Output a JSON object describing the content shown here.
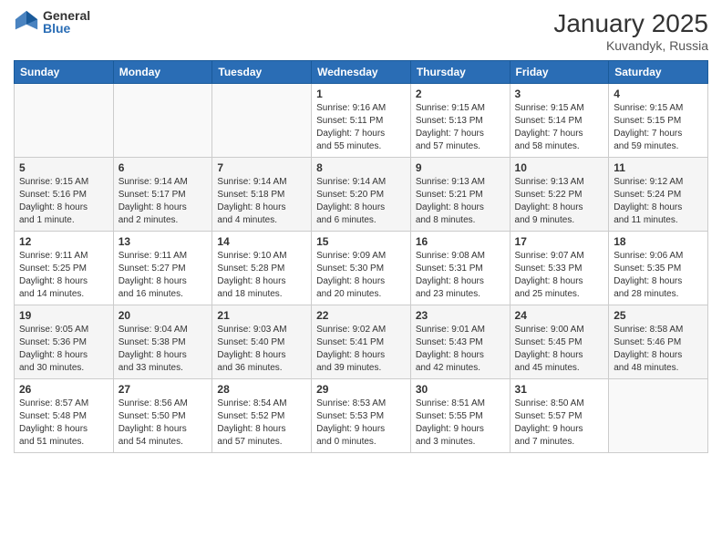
{
  "logo": {
    "general": "General",
    "blue": "Blue"
  },
  "title": "January 2025",
  "subtitle": "Kuvandyk, Russia",
  "days_header": [
    "Sunday",
    "Monday",
    "Tuesday",
    "Wednesday",
    "Thursday",
    "Friday",
    "Saturday"
  ],
  "weeks": [
    [
      {
        "day": "",
        "info": ""
      },
      {
        "day": "",
        "info": ""
      },
      {
        "day": "",
        "info": ""
      },
      {
        "day": "1",
        "info": "Sunrise: 9:16 AM\nSunset: 5:11 PM\nDaylight: 7 hours\nand 55 minutes."
      },
      {
        "day": "2",
        "info": "Sunrise: 9:15 AM\nSunset: 5:13 PM\nDaylight: 7 hours\nand 57 minutes."
      },
      {
        "day": "3",
        "info": "Sunrise: 9:15 AM\nSunset: 5:14 PM\nDaylight: 7 hours\nand 58 minutes."
      },
      {
        "day": "4",
        "info": "Sunrise: 9:15 AM\nSunset: 5:15 PM\nDaylight: 7 hours\nand 59 minutes."
      }
    ],
    [
      {
        "day": "5",
        "info": "Sunrise: 9:15 AM\nSunset: 5:16 PM\nDaylight: 8 hours\nand 1 minute."
      },
      {
        "day": "6",
        "info": "Sunrise: 9:14 AM\nSunset: 5:17 PM\nDaylight: 8 hours\nand 2 minutes."
      },
      {
        "day": "7",
        "info": "Sunrise: 9:14 AM\nSunset: 5:18 PM\nDaylight: 8 hours\nand 4 minutes."
      },
      {
        "day": "8",
        "info": "Sunrise: 9:14 AM\nSunset: 5:20 PM\nDaylight: 8 hours\nand 6 minutes."
      },
      {
        "day": "9",
        "info": "Sunrise: 9:13 AM\nSunset: 5:21 PM\nDaylight: 8 hours\nand 8 minutes."
      },
      {
        "day": "10",
        "info": "Sunrise: 9:13 AM\nSunset: 5:22 PM\nDaylight: 8 hours\nand 9 minutes."
      },
      {
        "day": "11",
        "info": "Sunrise: 9:12 AM\nSunset: 5:24 PM\nDaylight: 8 hours\nand 11 minutes."
      }
    ],
    [
      {
        "day": "12",
        "info": "Sunrise: 9:11 AM\nSunset: 5:25 PM\nDaylight: 8 hours\nand 14 minutes."
      },
      {
        "day": "13",
        "info": "Sunrise: 9:11 AM\nSunset: 5:27 PM\nDaylight: 8 hours\nand 16 minutes."
      },
      {
        "day": "14",
        "info": "Sunrise: 9:10 AM\nSunset: 5:28 PM\nDaylight: 8 hours\nand 18 minutes."
      },
      {
        "day": "15",
        "info": "Sunrise: 9:09 AM\nSunset: 5:30 PM\nDaylight: 8 hours\nand 20 minutes."
      },
      {
        "day": "16",
        "info": "Sunrise: 9:08 AM\nSunset: 5:31 PM\nDaylight: 8 hours\nand 23 minutes."
      },
      {
        "day": "17",
        "info": "Sunrise: 9:07 AM\nSunset: 5:33 PM\nDaylight: 8 hours\nand 25 minutes."
      },
      {
        "day": "18",
        "info": "Sunrise: 9:06 AM\nSunset: 5:35 PM\nDaylight: 8 hours\nand 28 minutes."
      }
    ],
    [
      {
        "day": "19",
        "info": "Sunrise: 9:05 AM\nSunset: 5:36 PM\nDaylight: 8 hours\nand 30 minutes."
      },
      {
        "day": "20",
        "info": "Sunrise: 9:04 AM\nSunset: 5:38 PM\nDaylight: 8 hours\nand 33 minutes."
      },
      {
        "day": "21",
        "info": "Sunrise: 9:03 AM\nSunset: 5:40 PM\nDaylight: 8 hours\nand 36 minutes."
      },
      {
        "day": "22",
        "info": "Sunrise: 9:02 AM\nSunset: 5:41 PM\nDaylight: 8 hours\nand 39 minutes."
      },
      {
        "day": "23",
        "info": "Sunrise: 9:01 AM\nSunset: 5:43 PM\nDaylight: 8 hours\nand 42 minutes."
      },
      {
        "day": "24",
        "info": "Sunrise: 9:00 AM\nSunset: 5:45 PM\nDaylight: 8 hours\nand 45 minutes."
      },
      {
        "day": "25",
        "info": "Sunrise: 8:58 AM\nSunset: 5:46 PM\nDaylight: 8 hours\nand 48 minutes."
      }
    ],
    [
      {
        "day": "26",
        "info": "Sunrise: 8:57 AM\nSunset: 5:48 PM\nDaylight: 8 hours\nand 51 minutes."
      },
      {
        "day": "27",
        "info": "Sunrise: 8:56 AM\nSunset: 5:50 PM\nDaylight: 8 hours\nand 54 minutes."
      },
      {
        "day": "28",
        "info": "Sunrise: 8:54 AM\nSunset: 5:52 PM\nDaylight: 8 hours\nand 57 minutes."
      },
      {
        "day": "29",
        "info": "Sunrise: 8:53 AM\nSunset: 5:53 PM\nDaylight: 9 hours\nand 0 minutes."
      },
      {
        "day": "30",
        "info": "Sunrise: 8:51 AM\nSunset: 5:55 PM\nDaylight: 9 hours\nand 3 minutes."
      },
      {
        "day": "31",
        "info": "Sunrise: 8:50 AM\nSunset: 5:57 PM\nDaylight: 9 hours\nand 7 minutes."
      },
      {
        "day": "",
        "info": ""
      }
    ]
  ]
}
